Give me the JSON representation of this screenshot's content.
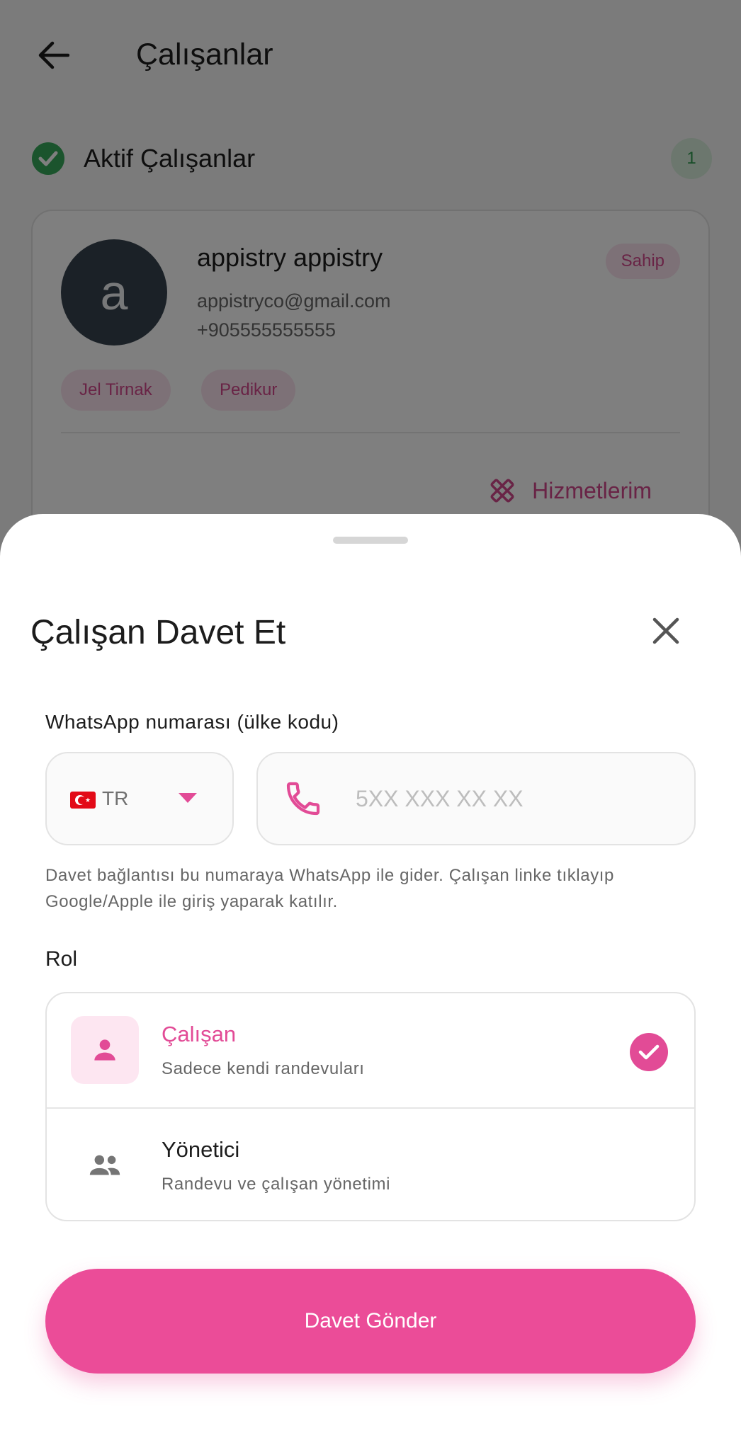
{
  "topbar": {
    "back_icon": "arrow-back-icon",
    "title": "Çalışanlar"
  },
  "active_section": {
    "icon": "check-circle-icon",
    "title": "Aktif Çalışanlar",
    "count": "1"
  },
  "employee_card": {
    "avatar_letter": "a",
    "name": "appistry appistry",
    "role_badge": "Sahip",
    "email": "appistryco@gmail.com",
    "phone": "+905555555555",
    "services": [
      "Jel Tirnak",
      "Pedikur"
    ],
    "services_link": {
      "label": "Hizmetlerim",
      "icon": "tools-icon"
    }
  },
  "sheet": {
    "title": "Çalışan Davet Et",
    "close_icon": "close-icon",
    "whatsapp_label": "WhatsApp numarası (ülke kodu)",
    "country": {
      "flag_icon": "turkey-flag-icon",
      "code": "TR",
      "arrow_icon": "dropdown-arrow-icon"
    },
    "phone": {
      "icon": "phone-icon",
      "value": "",
      "placeholder": "5XX XXX XX XX"
    },
    "helper_text": "Davet bağlantısı bu numaraya WhatsApp ile gider. Çalışan linke tıklayıp Google/Apple ile giriş yaparak katılır.",
    "role_label": "Rol",
    "roles": [
      {
        "title": "Çalışan",
        "description": "Sadece kendi randevuları",
        "icon": "person-icon",
        "selected": true
      },
      {
        "title": "Yönetici",
        "description": "Randevu ve çalışan yönetimi",
        "icon": "people-icon",
        "selected": false
      }
    ],
    "submit_label": "Davet Gönder"
  },
  "colors": {
    "accent": "#eb4c98",
    "accent_light": "#fde6f1",
    "success": "#37a85a",
    "avatar_bg": "#36434f"
  }
}
